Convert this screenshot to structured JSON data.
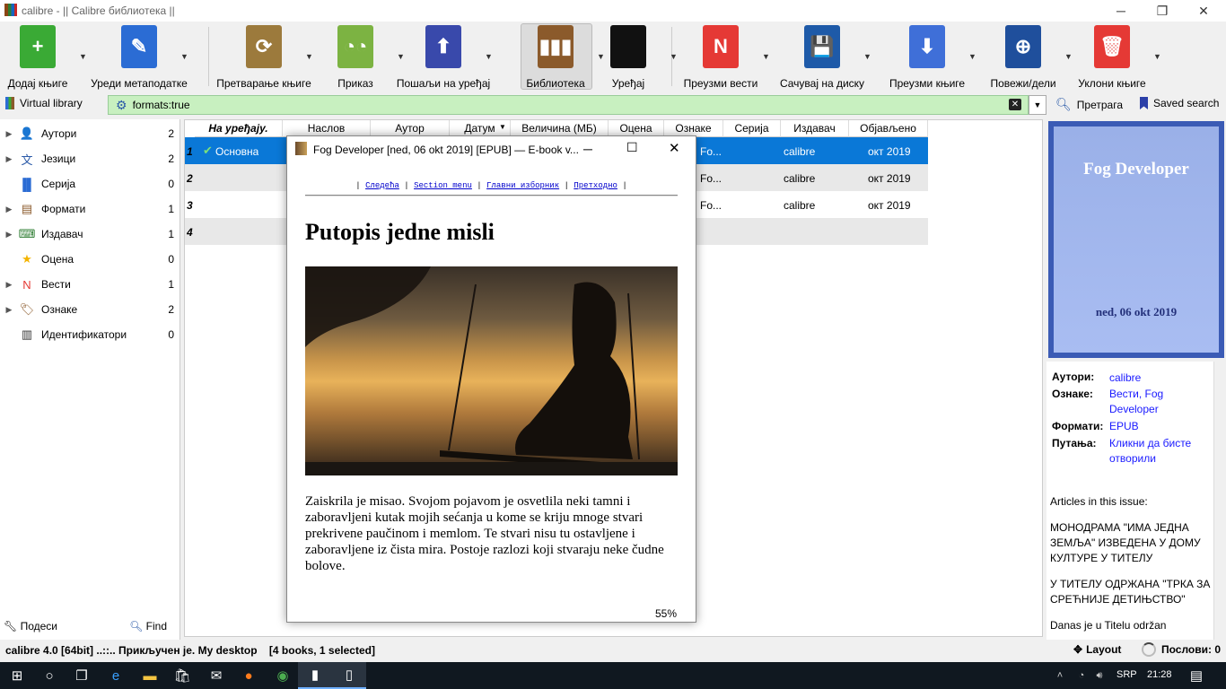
{
  "window": {
    "title": "calibre - || Calibre библиотека ||",
    "minimize": "─",
    "maximize": "❐",
    "close": "✕"
  },
  "toolbar": {
    "buttons": [
      {
        "label": "Додај књиге",
        "icon": "add-book-icon",
        "color": "#3aaa35",
        "glyph": "+"
      },
      {
        "label": "Уреди метаподатке",
        "icon": "edit-metadata-icon",
        "color": "#2b6cd4",
        "glyph": "✎"
      },
      {
        "label": "Претварање књиге",
        "icon": "convert-book-icon",
        "color": "#9c7a3c",
        "glyph": "⟳"
      },
      {
        "label": "Приказ",
        "icon": "view-book-icon",
        "color": "#7cb342",
        "glyph": "◔◔"
      },
      {
        "label": "Пошаљи на уређај",
        "icon": "send-to-device-icon",
        "color": "#3949ab",
        "glyph": "⬆"
      },
      {
        "label": "Библиотека",
        "icon": "library-icon",
        "color": "#8b5a2b",
        "glyph": "▮▮▮"
      },
      {
        "label": "Уређај",
        "icon": "device-icon",
        "color": "#111111",
        "glyph": ""
      },
      {
        "label": "Преузми вести",
        "icon": "fetch-news-icon",
        "color": "#e53935",
        "glyph": "N"
      },
      {
        "label": "Сачувај на диску",
        "icon": "save-to-disk-icon",
        "color": "#1e5aa8",
        "glyph": "💾"
      },
      {
        "label": "Преузми књиге",
        "icon": "get-books-icon",
        "color": "#3f6fd8",
        "glyph": "⬇"
      },
      {
        "label": "Повежи/дели",
        "icon": "connect-share-icon",
        "color": "#1f4f9c",
        "glyph": "⊕"
      },
      {
        "label": "Уклони књиге",
        "icon": "remove-books-icon",
        "color": "#e53935",
        "glyph": "🗑"
      }
    ]
  },
  "search": {
    "virtual_library": "Virtual library",
    "query": "formats:true",
    "search_label": "Претрага",
    "saved_search": "Saved search",
    "clear": "✕",
    "dropdown": "▼"
  },
  "sidebar": {
    "items": [
      {
        "label": "Аутори",
        "count": "2",
        "icon": "authors-icon",
        "expand": "▶",
        "glyph": "👤"
      },
      {
        "label": "Језици",
        "count": "2",
        "icon": "languages-icon",
        "expand": "▶",
        "glyph": "文"
      },
      {
        "label": "Серија",
        "count": "0",
        "icon": "series-icon",
        "expand": "",
        "glyph": "▐▌"
      },
      {
        "label": "Формати",
        "count": "1",
        "icon": "formats-icon",
        "expand": "▶",
        "glyph": "▤"
      },
      {
        "label": "Издавач",
        "count": "1",
        "icon": "publisher-icon",
        "expand": "▶",
        "glyph": "⌨"
      },
      {
        "label": "Оцена",
        "count": "0",
        "icon": "rating-star-icon",
        "expand": "",
        "glyph": "★"
      },
      {
        "label": "Вести",
        "count": "1",
        "icon": "news-icon",
        "expand": "▶",
        "glyph": "N"
      },
      {
        "label": "Ознаке",
        "count": "2",
        "icon": "tags-icon",
        "expand": "▶",
        "glyph": "🏷"
      },
      {
        "label": "Идентификатори",
        "count": "0",
        "icon": "identifiers-icon",
        "expand": "",
        "glyph": "▥"
      }
    ],
    "configure": "Подеси",
    "find": "Find"
  },
  "booklist": {
    "columns": [
      "На уређају.",
      "Наслов",
      "Аутор",
      "Датум",
      "Величина (МБ)",
      "Оцена",
      "Ознаке",
      "Серија",
      "Издавач",
      "Објављено"
    ],
    "rows": [
      {
        "num": "1",
        "device": "Основна",
        "tags": "Fo...",
        "publisher": "calibre",
        "published": "окт 2019"
      },
      {
        "num": "2",
        "device": "",
        "tags": "Fo...",
        "publisher": "calibre",
        "published": "окт 2019"
      },
      {
        "num": "3",
        "device": "",
        "tags": "Fo...",
        "publisher": "calibre",
        "published": "окт 2019"
      },
      {
        "num": "4",
        "device": "",
        "tags": "",
        "publisher": "",
        "published": ""
      }
    ]
  },
  "cover": {
    "title": "Fog Developer",
    "date": "ned, 06 okt 2019"
  },
  "details": {
    "authors_k": "Аутори:",
    "authors_v": "calibre",
    "tags_k": "Ознаке:",
    "tags_v": "Вести, Fog Developer",
    "formats_k": "Формати:",
    "formats_v": "EPUB",
    "path_k": "Путања:",
    "path_v": "Кликни да бисте отворили",
    "articles": "Articles in this issue:",
    "a1": "МОНОДРАМА \"ИМА ЈЕДНА ЗЕМЉА\" ИЗВЕДЕНА У ДОМУ КУЛТУРЕ У ТИТЕЛУ",
    "a2": "У ТИТЕЛУ ОДРЖАНА \"ТРКА ЗА СРЕЋНИЈЕ ДЕТИЊСТВО\"",
    "a3": "Danas je u Titelu održan"
  },
  "viewer": {
    "title": "Fog Developer [ned, 06 okt 2019] [EPUB] — E-book v...",
    "nav": [
      "Следећа",
      "Section menu",
      "Главни изборник",
      "Претходно"
    ],
    "heading": "Putopis jedne misli",
    "paragraph": "Zaiskrila je misao. Svojom pojavom je osvetlila neki tamni i zaboravljeni kutak mojih sećanja u kome se kriju mnoge stvari prekrivene paučinom i memlom. Te stvari nisu tu ostavljene i zaboravljene iz čista mira. Postoje razlozi koji stvaraju neke čudne bolove.",
    "progress_text": "55%"
  },
  "status": {
    "text": "calibre 4.0 [64bit] ..::.. Прикључен је. My desktop    [4 books, 1 selected]",
    "layout": "Layout",
    "jobs": "Послови: 0"
  },
  "taskbar": {
    "lang": "SRP",
    "time": "21:28"
  }
}
